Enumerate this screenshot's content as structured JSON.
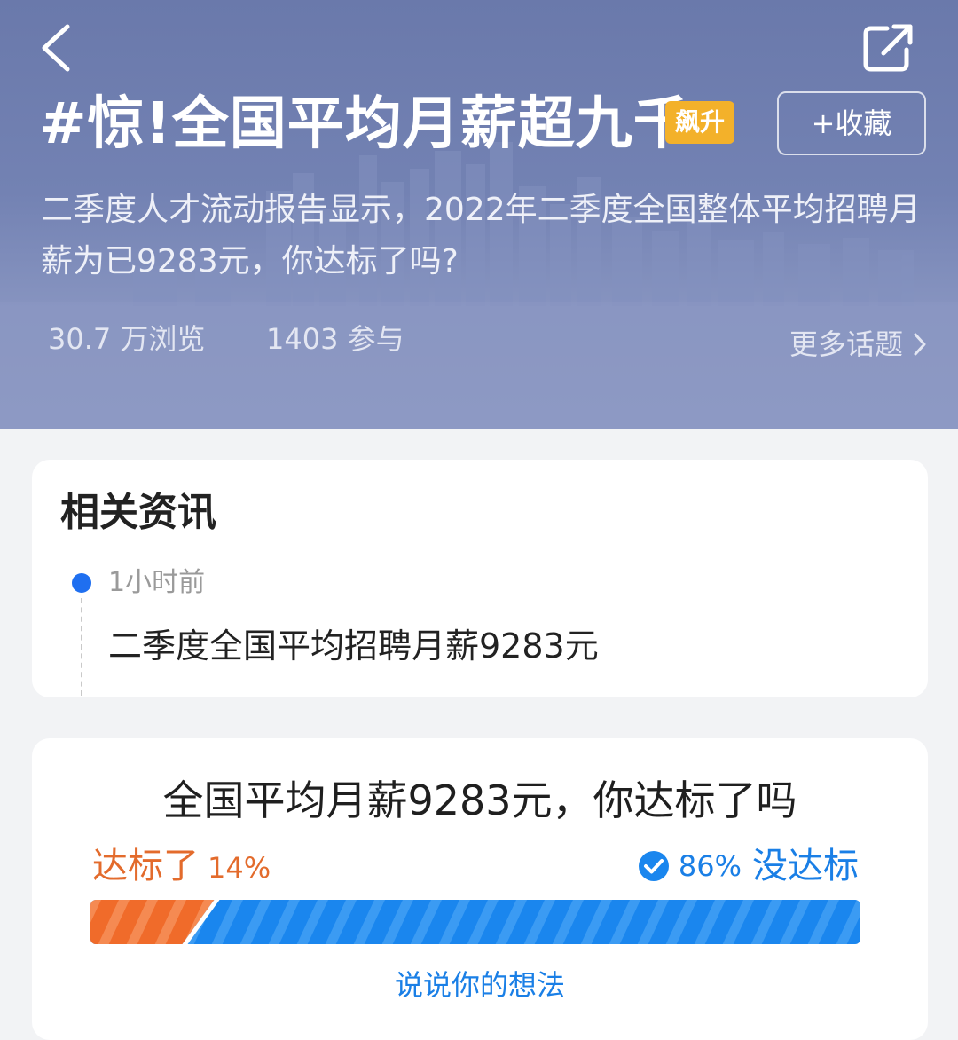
{
  "header": {
    "title": "#惊!全国平均月薪超九千",
    "badge": "飙升",
    "favorite_label": "+收藏",
    "description": "二季度人才流动报告显示，2022年二季度全国整体平均招聘月薪为已9283元，你达标了吗?",
    "views": "30.7 万浏览",
    "participants": "1403 参与",
    "more_topics": "更多话题",
    "colors": {
      "badge": "#f3b12a",
      "header_top": "#6a79ab",
      "header_bottom": "#8d99c3"
    }
  },
  "news": {
    "heading": "相关资讯",
    "items": [
      {
        "time": "1小时前",
        "title": "二季度全国平均招聘月薪9283元"
      }
    ]
  },
  "poll": {
    "question": "全国平均月薪9283元，你达标了吗",
    "option_left": {
      "label": "达标了",
      "percent": "14%",
      "fraction": 0.14,
      "color": "#f06b2a"
    },
    "option_right": {
      "label": "没达标",
      "percent": "86%",
      "fraction": 0.86,
      "color": "#1a86ee",
      "selected": true
    },
    "discuss_label": "说说你的想法"
  },
  "icons": [
    "back-icon",
    "share-icon",
    "chevron-right-icon",
    "check-circle-icon"
  ]
}
